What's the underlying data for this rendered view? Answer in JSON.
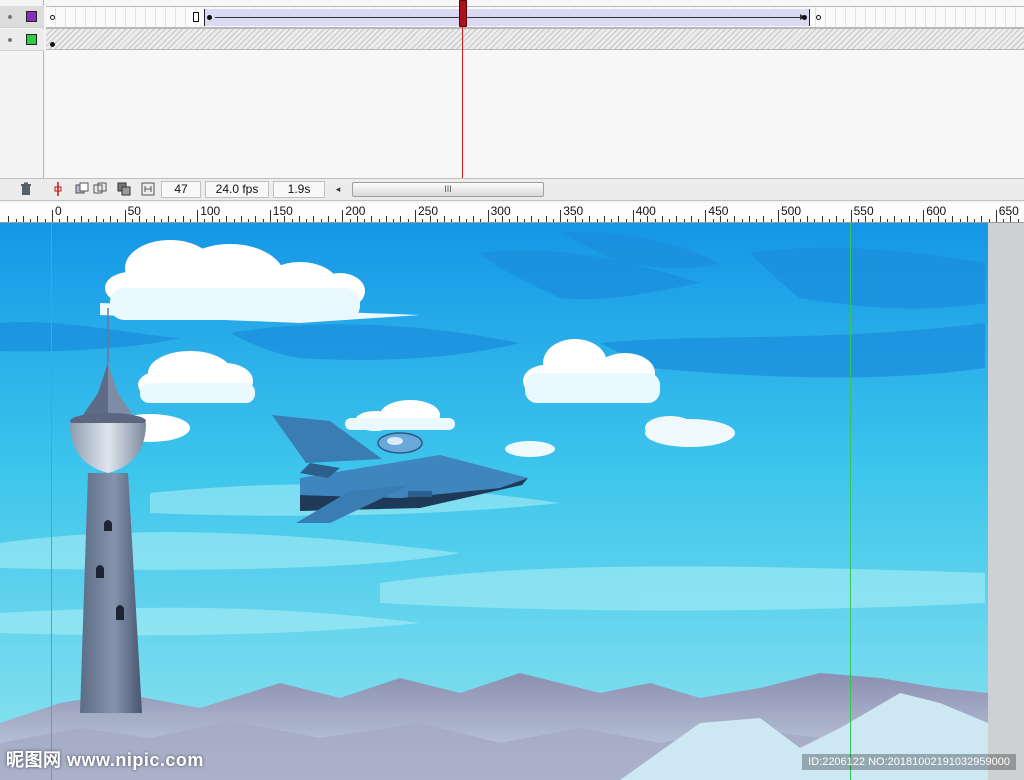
{
  "timeline": {
    "layers": [
      {
        "swatch_color": "#8a2bc2"
      },
      {
        "swatch_color": "#2ecc40"
      }
    ],
    "current_frame": "47",
    "frame_rate": "24.0 fps",
    "elapsed_time": "1.9s",
    "scroll_thumb_label": "III",
    "scroll_arrow": "◂",
    "icons": [
      "trash-icon",
      "onion-skin-icon",
      "onion-skin-outlines-icon",
      "edit-multiple-frames-icon",
      "modify-onion-markers-icon"
    ]
  },
  "ruler": {
    "labels": [
      "0",
      "50",
      "100",
      "150",
      "200",
      "250",
      "300",
      "350",
      "400",
      "450",
      "500",
      "550",
      "600",
      "650"
    ]
  },
  "stage": {
    "sky_top_color": "#1596e6",
    "sky_bottom_color": "#8fe4ef",
    "guide_color": "#35c659"
  },
  "watermark": {
    "left": "昵图网 www.nipic.com",
    "right": "ID:2206122 NO:20181002191032959000"
  }
}
